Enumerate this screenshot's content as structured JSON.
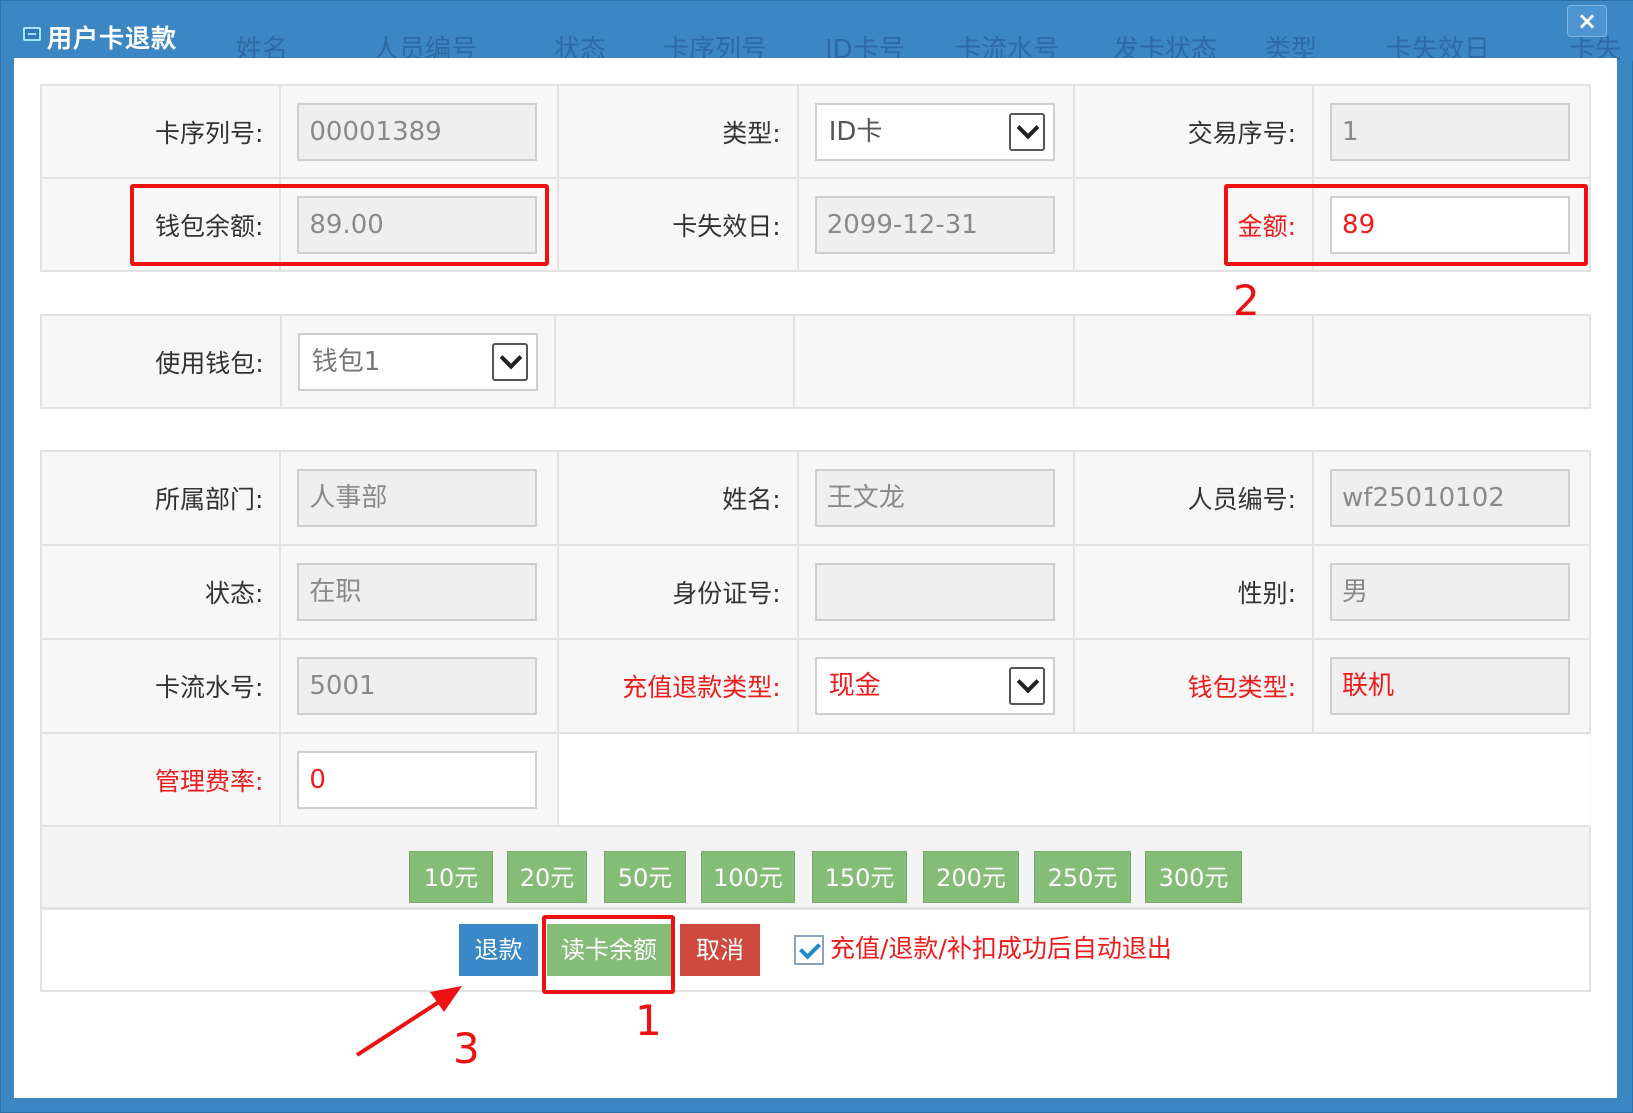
{
  "window": {
    "title": "用户卡退款",
    "close_label": "×"
  },
  "background_columns": [
    "姓名",
    "人员编号",
    "状态",
    "卡序列号",
    "ID卡号",
    "卡流水号",
    "发卡状态",
    "类型",
    "卡失效日",
    "卡失"
  ],
  "card": {
    "serial_label": "卡序列号:",
    "serial_value": "00001389",
    "type_label": "类型:",
    "type_value": "ID卡",
    "trade_seq_label": "交易序号:",
    "trade_seq_value": "1",
    "balance_label": "钱包余额:",
    "balance_value": "89.00",
    "expire_label": "卡失效日:",
    "expire_value": "2099-12-31",
    "amount_label": "金额:",
    "amount_value": "89"
  },
  "wallet": {
    "label": "使用钱包:",
    "value": "钱包1"
  },
  "person": {
    "dept_label": "所属部门:",
    "dept_value": "人事部",
    "name_label": "姓名:",
    "name_value": "王文龙",
    "id_label": "人员编号:",
    "id_value": "wf25010102",
    "status_label": "状态:",
    "status_value": "在职",
    "idcard_label": "身份证号:",
    "idcard_value": "",
    "gender_label": "性别:",
    "gender_value": "男",
    "cardflow_label": "卡流水号:",
    "cardflow_value": "5001",
    "refund_type_label": "充值退款类型:",
    "refund_type_value": "现金",
    "wallet_type_label": "钱包类型:",
    "wallet_type_value": "联机",
    "fee_label": "管理费率:",
    "fee_value": "0"
  },
  "amount_buttons": [
    "10元",
    "20元",
    "50元",
    "100元",
    "150元",
    "200元",
    "250元",
    "300元"
  ],
  "actions": {
    "refund": "退款",
    "read_balance": "读卡余额",
    "cancel": "取消",
    "auto_exit_label": "充值/退款/补扣成功后自动退出",
    "auto_exit_checked": true
  },
  "annotations": {
    "n1": "1",
    "n2": "2",
    "n3": "3"
  },
  "colors": {
    "highlight": "#ee1111",
    "green": "#85bd78",
    "blue": "#3a88c8",
    "red": "#cf4a3e",
    "label_red": "#ee1c1c"
  }
}
